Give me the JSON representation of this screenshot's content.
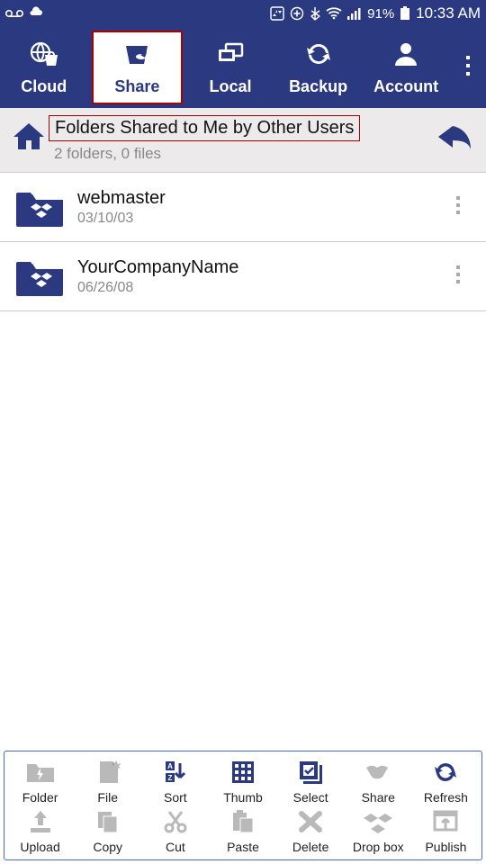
{
  "status": {
    "battery_pct": "91%",
    "time": "10:33 AM"
  },
  "nav": {
    "tabs": [
      {
        "id": "cloud",
        "label": "Cloud"
      },
      {
        "id": "share",
        "label": "Share"
      },
      {
        "id": "local",
        "label": "Local"
      },
      {
        "id": "backup",
        "label": "Backup"
      },
      {
        "id": "account",
        "label": "Account"
      }
    ],
    "active": "share"
  },
  "subheader": {
    "title": "Folders Shared to Me by Other Users",
    "subtitle": "2 folders, 0 files"
  },
  "folders": [
    {
      "name": "webmaster",
      "date": "03/10/03"
    },
    {
      "name": "YourCompanyName",
      "date": "06/26/08"
    }
  ],
  "tools_row1": [
    {
      "id": "folder",
      "label": "Folder"
    },
    {
      "id": "file",
      "label": "File"
    },
    {
      "id": "sort",
      "label": "Sort"
    },
    {
      "id": "thumb",
      "label": "Thumb"
    },
    {
      "id": "select",
      "label": "Select"
    },
    {
      "id": "share",
      "label": "Share"
    },
    {
      "id": "refresh",
      "label": "Refresh"
    }
  ],
  "tools_row2": [
    {
      "id": "upload",
      "label": "Upload"
    },
    {
      "id": "copy",
      "label": "Copy"
    },
    {
      "id": "cut",
      "label": "Cut"
    },
    {
      "id": "paste",
      "label": "Paste"
    },
    {
      "id": "delete",
      "label": "Delete"
    },
    {
      "id": "dropbox",
      "label": "Drop box"
    },
    {
      "id": "publish",
      "label": "Publish"
    }
  ],
  "colors": {
    "primary": "#2b3a80",
    "disabled": "#b9b9b9"
  }
}
